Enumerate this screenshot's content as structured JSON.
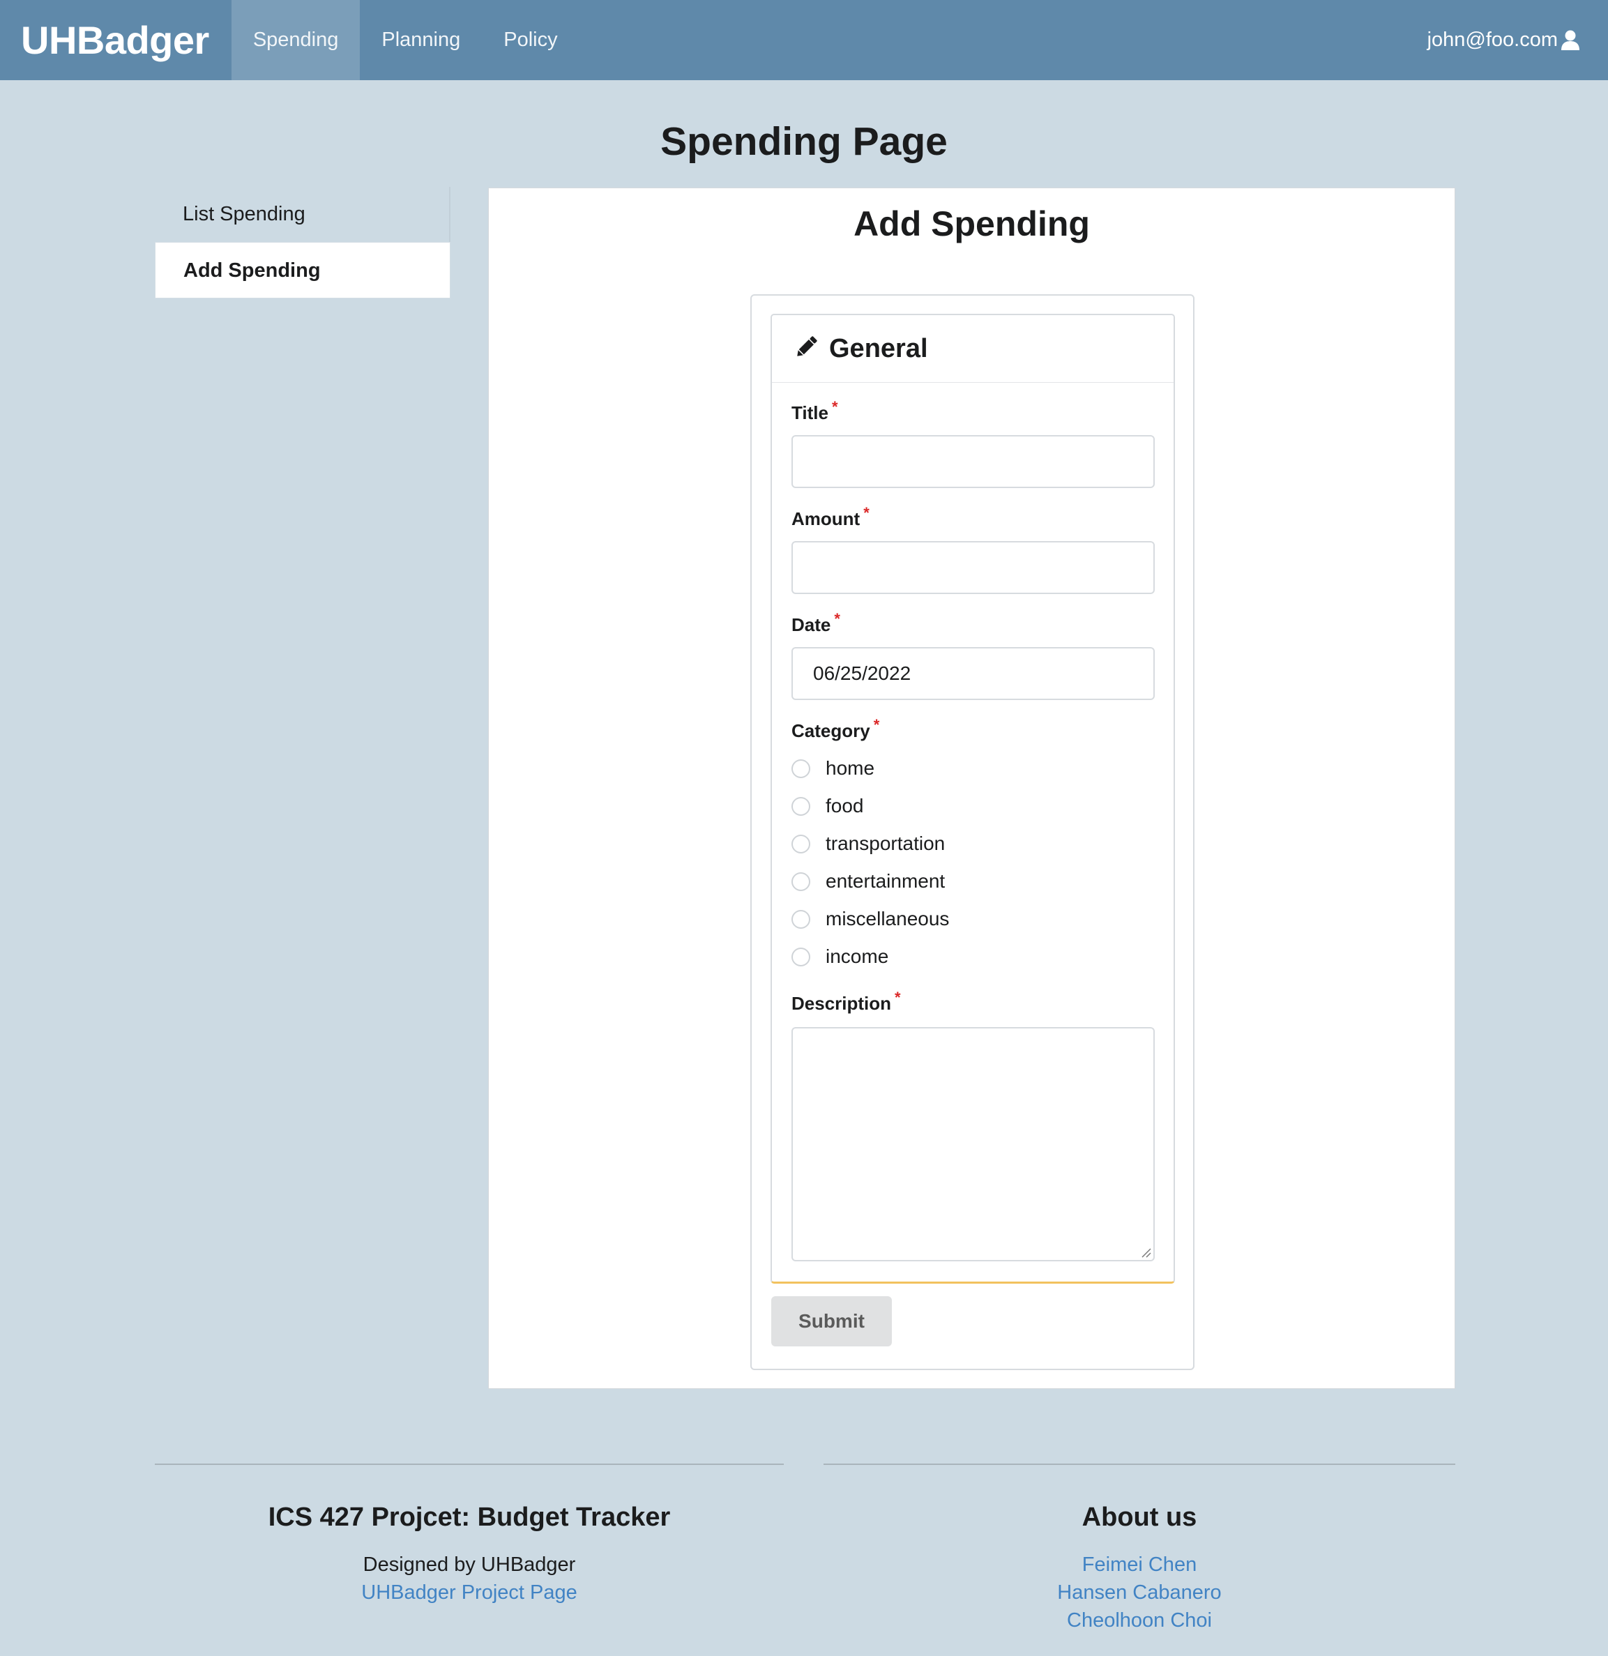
{
  "navbar": {
    "brand": "UHBadger",
    "items": [
      {
        "label": "Spending",
        "active": true
      },
      {
        "label": "Planning",
        "active": false
      },
      {
        "label": "Policy",
        "active": false
      }
    ],
    "user_email": "john@foo.com",
    "user_icon": "user-icon"
  },
  "page": {
    "title": "Spending Page"
  },
  "sidebar": {
    "items": [
      {
        "label": "List Spending",
        "active": false
      },
      {
        "label": "Add Spending",
        "active": true
      }
    ]
  },
  "form": {
    "title": "Add Spending",
    "section_title": "General",
    "section_icon": "pencil-icon",
    "fields": {
      "title": {
        "label": "Title",
        "value": ""
      },
      "amount": {
        "label": "Amount",
        "value": ""
      },
      "date": {
        "label": "Date",
        "value": "06/25/2022"
      },
      "category": {
        "label": "Category",
        "options": [
          "home",
          "food",
          "transportation",
          "entertainment",
          "miscellaneous",
          "income"
        ],
        "selected": null
      },
      "description": {
        "label": "Description",
        "value": ""
      }
    },
    "required_marker": "*",
    "submit_label": "Submit"
  },
  "footer": {
    "left": {
      "heading": "ICS 427 Projcet: Budget Tracker",
      "designed_by": "Designed by UHBadger",
      "link": "UHBadger Project Page"
    },
    "right": {
      "heading": "About us",
      "members": [
        "Feimei Chen",
        "Hansen Cabanero",
        "Cheolhoon Choi"
      ]
    }
  },
  "colors": {
    "navbar": "#5f89aa",
    "navbar_active": "#7b9eb9",
    "background": "#ccdae3",
    "required": "#db2828",
    "link": "#4183c4",
    "card_accent": "#f2c25e"
  }
}
